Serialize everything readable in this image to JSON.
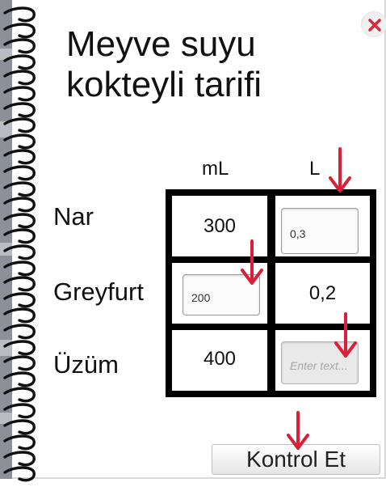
{
  "window": {
    "close_icon": "close-x-icon",
    "close_color": "#d62a38"
  },
  "binding": {
    "icon": "spiral-ring-icon"
  },
  "title": "Meyve suyu kokteyli tarifi",
  "table": {
    "columns": [
      "mL",
      "L"
    ],
    "rows": [
      {
        "label": "Nar",
        "ml": {
          "type": "text",
          "value": "300"
        },
        "l": {
          "type": "input",
          "value": "0,3",
          "placeholder": ""
        }
      },
      {
        "label": "Greyfurt",
        "ml": {
          "type": "input",
          "value": "200",
          "placeholder": ""
        },
        "l": {
          "type": "text",
          "value": "0,2"
        }
      },
      {
        "label": "Üzüm",
        "ml": {
          "type": "text",
          "value": "400"
        },
        "l": {
          "type": "input",
          "value": "",
          "placeholder": "Enter text...",
          "disabled": true
        }
      }
    ]
  },
  "actions": {
    "check_label": "Kontrol Et"
  },
  "hints": {
    "arrow_icon": "arrow-down-icon",
    "arrow_color": "#d8203a"
  }
}
